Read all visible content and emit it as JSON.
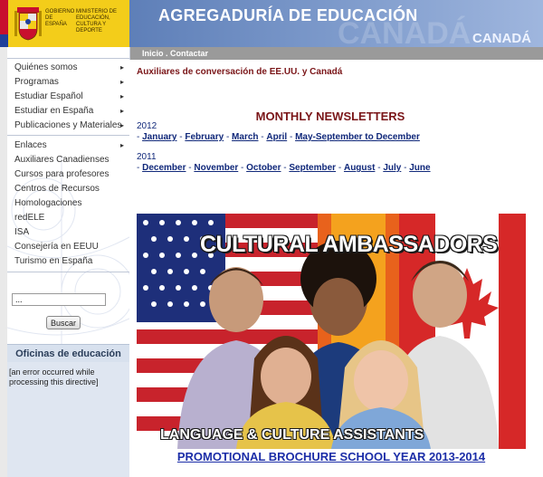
{
  "header": {
    "gov_label": "GOBIERNO DE ESPAÑA",
    "ministry_label": "MINISTERIO DE EDUCACIÓN, CULTURA Y DEPORTE",
    "title": "AGREGADURÍA DE EDUCACIÓN",
    "country": "CANADÁ",
    "watermark": "CANADÁ"
  },
  "nav": {
    "links": "Inicio . Contactar"
  },
  "sidebar": {
    "menu1": [
      {
        "label": "Quiénes somos",
        "arrow": "▸"
      },
      {
        "label": "Programas",
        "arrow": "▸"
      },
      {
        "label": "Estudiar Español",
        "arrow": "▸"
      },
      {
        "label": "Estudiar en España",
        "arrow": "▸"
      },
      {
        "label": "Publicaciones y Materiales",
        "arrow": "▸"
      }
    ],
    "menu2": [
      {
        "label": "Enlaces",
        "arrow": "▸"
      },
      {
        "label": "Auxiliares Canadienses"
      },
      {
        "label": "Cursos para profesores"
      },
      {
        "label": "Centros de Recursos"
      },
      {
        "label": "Homologaciones"
      },
      {
        "label": "redELE"
      },
      {
        "label": "ISA"
      },
      {
        "label": "Consejería en EEUU"
      },
      {
        "label": "Turismo en España"
      }
    ],
    "search": {
      "value": "...",
      "button": "Buscar"
    },
    "offices": {
      "heading": "Oficinas de educación",
      "body": "[an error occurred while processing this directive]"
    }
  },
  "main": {
    "aux_heading": "Auxiliares de conversación de EE.UU. y Canadá",
    "news_title": "MONTHLY NEWSLETTERS",
    "years": [
      {
        "year": "2012",
        "months": [
          "January",
          "February",
          "March",
          "April",
          "May-September to December"
        ]
      },
      {
        "year": "2011",
        "months": [
          "December",
          "November",
          "October",
          "September",
          "August",
          "July",
          "June"
        ]
      }
    ],
    "banner": {
      "title": "CULTURAL AMBASSADORS",
      "subtitle": "LANGUAGE & CULTURE ASSISTANTS"
    },
    "promo": "PROMOTIONAL BROCHURE SCHOOL YEAR 2013-2014"
  },
  "colors": {
    "header_blue": "#7d9acb",
    "spain_yellow": "#f3cd1a",
    "spain_red": "#c8102e",
    "heading_red": "#7a1518",
    "link_blue": "#10287a",
    "promo_blue": "#1c2ea8"
  }
}
